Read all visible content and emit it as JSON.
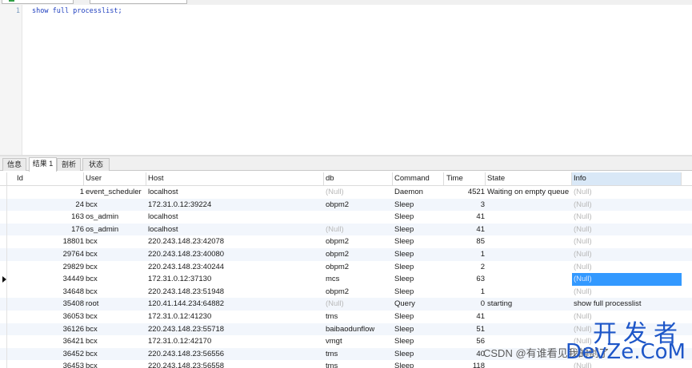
{
  "editor": {
    "lines": [
      {
        "num": "1",
        "code": "show full processlist;"
      }
    ]
  },
  "tabs": [
    {
      "label": "信息",
      "active": false
    },
    {
      "label": "结果 1",
      "active": true
    },
    {
      "label": "剖析",
      "active": false
    },
    {
      "label": "状态",
      "active": false
    }
  ],
  "grid": {
    "columns": [
      "Id",
      "User",
      "Host",
      "db",
      "Command",
      "Time",
      "State",
      "Info"
    ],
    "rows": [
      {
        "id": "1",
        "user": "event_scheduler",
        "host": "localhost",
        "db": "(Null)",
        "command": "Daemon",
        "time": "4521",
        "state": "Waiting on empty queue",
        "info": "(Null)"
      },
      {
        "id": "24",
        "user": "bcx",
        "host": "172.31.0.12:39224",
        "db": "obpm2",
        "command": "Sleep",
        "time": "3",
        "state": "",
        "info": "(Null)"
      },
      {
        "id": "163",
        "user": "os_admin",
        "host": "localhost",
        "db": "",
        "command": "Sleep",
        "time": "41",
        "state": "",
        "info": "(Null)"
      },
      {
        "id": "176",
        "user": "os_admin",
        "host": "localhost",
        "db": "(Null)",
        "command": "Sleep",
        "time": "41",
        "state": "",
        "info": "(Null)"
      },
      {
        "id": "18801",
        "user": "bcx",
        "host": "220.243.148.23:42078",
        "db": "obpm2",
        "command": "Sleep",
        "time": "85",
        "state": "",
        "info": "(Null)"
      },
      {
        "id": "29764",
        "user": "bcx",
        "host": "220.243.148.23:40080",
        "db": "obpm2",
        "command": "Sleep",
        "time": "1",
        "state": "",
        "info": "(Null)"
      },
      {
        "id": "29829",
        "user": "bcx",
        "host": "220.243.148.23:40244",
        "db": "obpm2",
        "command": "Sleep",
        "time": "2",
        "state": "",
        "info": "(Null)"
      },
      {
        "id": "34449",
        "user": "bcx",
        "host": "172.31.0.12:37130",
        "db": "mcs",
        "command": "Sleep",
        "time": "63",
        "state": "",
        "info": "(Null)"
      },
      {
        "id": "34648",
        "user": "bcx",
        "host": "220.243.148.23:51948",
        "db": "obpm2",
        "command": "Sleep",
        "time": "1",
        "state": "",
        "info": "(Null)"
      },
      {
        "id": "35408",
        "user": "root",
        "host": "120.41.144.234:64882",
        "db": "(Null)",
        "command": "Query",
        "time": "0",
        "state": "starting",
        "info": "show full processlist"
      },
      {
        "id": "36053",
        "user": "bcx",
        "host": "172.31.0.12:41230",
        "db": "tms",
        "command": "Sleep",
        "time": "41",
        "state": "",
        "info": "(Null)"
      },
      {
        "id": "36126",
        "user": "bcx",
        "host": "220.243.148.23:55718",
        "db": "baibaodunflow",
        "command": "Sleep",
        "time": "51",
        "state": "",
        "info": "(Null)"
      },
      {
        "id": "36421",
        "user": "bcx",
        "host": "172.31.0.12:42170",
        "db": "vmgt",
        "command": "Sleep",
        "time": "56",
        "state": "",
        "info": "(Null)"
      },
      {
        "id": "36452",
        "user": "bcx",
        "host": "220.243.148.23:56556",
        "db": "tms",
        "command": "Sleep",
        "time": "40",
        "state": "",
        "info": "(Null)"
      },
      {
        "id": "36453",
        "user": "bcx",
        "host": "220.243.148.23:56558",
        "db": "tms",
        "command": "Sleep",
        "time": "118",
        "state": "",
        "info": "(Null)"
      }
    ],
    "selected_row_index": 7
  },
  "watermark": {
    "csdn": "CSDN @有谁看见我的剑了",
    "logo_cn": "开发者",
    "logo_en": "DevZe.CoM"
  },
  "colors": {
    "selection": "#3399ff",
    "code_text": "#1f3fbf",
    "null_text": "#b8b8b8",
    "watermark_blue": "#1d56c8"
  }
}
